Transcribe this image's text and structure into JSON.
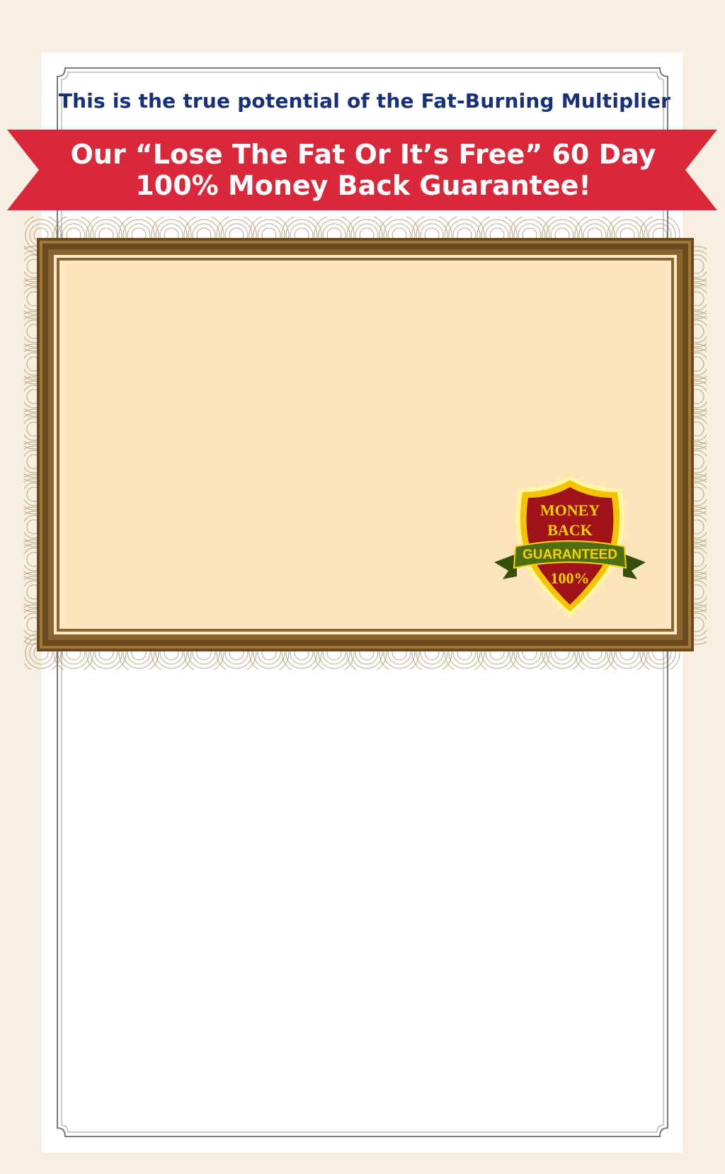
{
  "header": {
    "subtitle": "This is the true potential of the Fat-Burning Multiplier"
  },
  "banner": {
    "line1": "Our “Lose The Fat Or It’s Free” 60 Day",
    "line2": "100% Money Back Guarantee!"
  },
  "badge": {
    "line1": "MONEY",
    "line2": "BACK",
    "ribbon": "GUARANTEED",
    "percent": "100%"
  },
  "colors": {
    "page_bg": "#f7f0e2",
    "subtitle": "#17307a",
    "banner": "#d9283a",
    "certificate_fill": "#fde4bd",
    "certificate_border": "#7a5424",
    "shield_red": "#a01218",
    "shield_gold": "#f5d200",
    "badge_ribbon": "#4f6e0f"
  }
}
